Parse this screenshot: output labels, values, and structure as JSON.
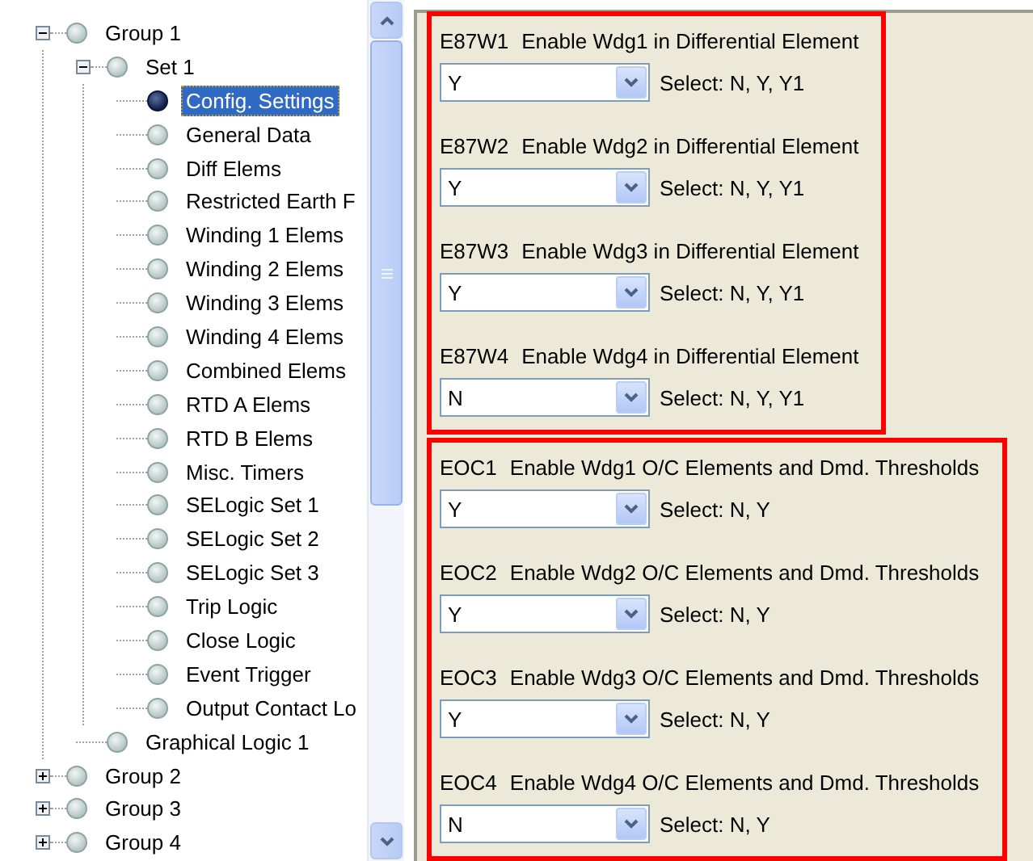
{
  "tree": [
    {
      "label": "Group 1",
      "expanded": true,
      "selected": false,
      "children": [
        {
          "label": "Set 1",
          "expanded": true,
          "selected": false,
          "children": [
            {
              "label": "Config. Settings",
              "selected": true
            },
            {
              "label": "General Data",
              "selected": false
            },
            {
              "label": "Diff Elems",
              "selected": false
            },
            {
              "label": "Restricted Earth F",
              "selected": false
            },
            {
              "label": "Winding 1 Elems",
              "selected": false
            },
            {
              "label": "Winding 2 Elems",
              "selected": false
            },
            {
              "label": "Winding 3 Elems",
              "selected": false
            },
            {
              "label": "Winding 4 Elems",
              "selected": false
            },
            {
              "label": "Combined Elems",
              "selected": false
            },
            {
              "label": "RTD A Elems",
              "selected": false
            },
            {
              "label": "RTD B Elems",
              "selected": false
            },
            {
              "label": "Misc. Timers",
              "selected": false
            },
            {
              "label": "SELogic Set 1",
              "selected": false
            },
            {
              "label": "SELogic Set 2",
              "selected": false
            },
            {
              "label": "SELogic Set 3",
              "selected": false
            },
            {
              "label": "Trip Logic",
              "selected": false
            },
            {
              "label": "Close Logic",
              "selected": false
            },
            {
              "label": "Event Trigger",
              "selected": false
            },
            {
              "label": "Output Contact Lo",
              "selected": false
            }
          ]
        },
        {
          "label": "Graphical Logic 1",
          "selected": false
        }
      ]
    },
    {
      "label": "Group 2",
      "expanded": false,
      "selected": false
    },
    {
      "label": "Group 3",
      "expanded": false,
      "selected": false
    },
    {
      "label": "Group 4",
      "expanded": false,
      "selected": false
    }
  ],
  "sections": [
    {
      "settings": [
        {
          "code": "E87W1",
          "description": "Enable Wdg1 in Differential Element",
          "value": "Y",
          "hint": "Select: N, Y, Y1"
        },
        {
          "code": "E87W2",
          "description": "Enable Wdg2 in Differential Element",
          "value": "Y",
          "hint": "Select: N, Y, Y1"
        },
        {
          "code": "E87W3",
          "description": "Enable Wdg3 in Differential Element",
          "value": "Y",
          "hint": "Select: N, Y, Y1"
        },
        {
          "code": "E87W4",
          "description": "Enable Wdg4 in Differential Element",
          "value": "N",
          "hint": "Select: N, Y, Y1"
        }
      ]
    },
    {
      "settings": [
        {
          "code": "EOC1",
          "description": "Enable Wdg1 O/C Elements and Dmd. Thresholds",
          "value": "Y",
          "hint": "Select: N, Y"
        },
        {
          "code": "EOC2",
          "description": "Enable Wdg2 O/C Elements and Dmd. Thresholds",
          "value": "Y",
          "hint": "Select: N, Y"
        },
        {
          "code": "EOC3",
          "description": "Enable Wdg3 O/C Elements and Dmd. Thresholds",
          "value": "Y",
          "hint": "Select: N, Y"
        },
        {
          "code": "EOC4",
          "description": "Enable Wdg4 O/C Elements and Dmd. Thresholds",
          "value": "N",
          "hint": "Select: N, Y"
        }
      ]
    }
  ]
}
